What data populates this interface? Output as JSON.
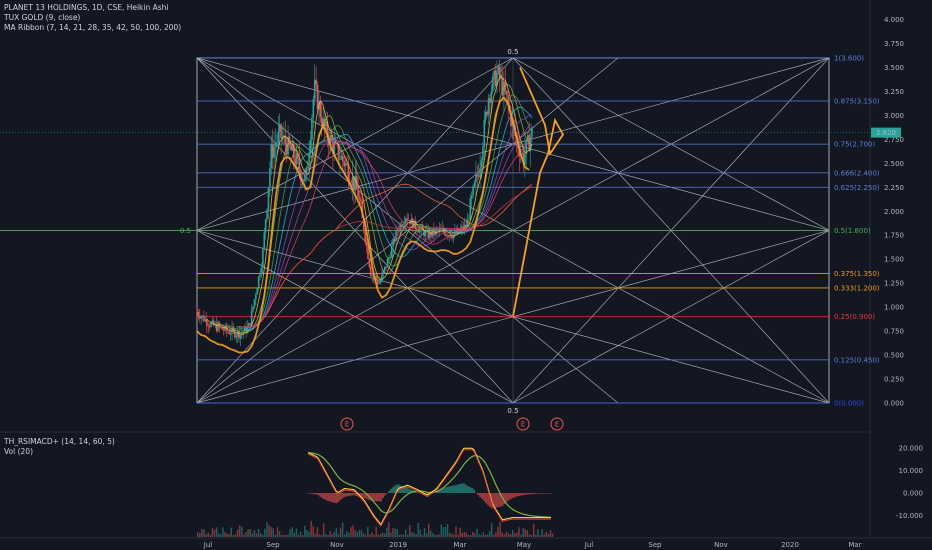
{
  "legend": {
    "symbol_line": "PLANET 13 HOLDINGS, 1D, CSE, Heikin Ashi",
    "indicator_1": "TUX GOLD (9, close)",
    "indicator_2": "MA Ribbon (7, 14, 21, 28, 35, 42, 50, 100, 200)",
    "lower_1": "TH_RSIMACD+ (14, 14, 60, 5)",
    "lower_2": "Vol (20)"
  },
  "colors": {
    "background": "#131722",
    "up": "#26a69a",
    "down": "#ef5350",
    "gann": "#c8cbd4",
    "orange": "#f7a21b",
    "blue_level": "#5b7fd6",
    "green_level": "#4caf50",
    "orange_level": "#f39c12",
    "red_level": "#e53935",
    "price_tag": "#26a69a"
  },
  "chart_data": {
    "type": "candlestick",
    "x_ticks": [
      "Jul",
      "Sep",
      "Nov",
      "2019",
      "Mar",
      "May",
      "Jul",
      "Sep",
      "Nov",
      "2020",
      "Mar"
    ],
    "y_ticks": [
      "4.000",
      "3.750",
      "3.500",
      "3.250",
      "3.000",
      "2.750",
      "2.500",
      "2.250",
      "2.000",
      "1.750",
      "1.500",
      "1.250",
      "1.000",
      "0.750",
      "0.500",
      "0.250",
      "0.000"
    ],
    "ylim": [
      -0.15,
      4.1
    ],
    "last_price": "2.820",
    "levels": [
      {
        "label": "1(3.600)",
        "value": 3.6,
        "color": "blue"
      },
      {
        "label": "0.875(3.150)",
        "value": 3.15,
        "color": "blue"
      },
      {
        "label": "0.75(2.700)",
        "value": 2.7,
        "color": "blue"
      },
      {
        "label": "0.666(2.400)",
        "value": 2.4,
        "color": "blue"
      },
      {
        "label": "0.625(2.250)",
        "value": 2.25,
        "color": "blue"
      },
      {
        "label": "0.5(1.800)",
        "value": 1.8,
        "color": "green"
      },
      {
        "label": "0.375(1.350)",
        "value": 1.35,
        "color": "orange"
      },
      {
        "label": "0.333(1.200)",
        "value": 1.2,
        "color": "orange"
      },
      {
        "label": "0.25(0.900)",
        "value": 0.9,
        "color": "red"
      },
      {
        "label": "0.125(0.450)",
        "value": 0.45,
        "color": "blue"
      },
      {
        "label": "0(0.000)",
        "value": 0.0,
        "color": "navy"
      }
    ],
    "gann_labels": [
      "0.5",
      "0.5",
      "0.5"
    ],
    "event_markers": [
      "E",
      "E",
      "E"
    ],
    "price_path": [
      [
        0,
        0.95
      ],
      [
        0.03,
        0.82
      ],
      [
        0.07,
        0.75
      ],
      [
        0.1,
        0.72
      ],
      [
        0.12,
        0.8
      ],
      [
        0.15,
        1.5
      ],
      [
        0.17,
        2.6
      ],
      [
        0.19,
        2.8
      ],
      [
        0.22,
        2.6
      ],
      [
        0.25,
        2.3
      ],
      [
        0.27,
        3.3
      ],
      [
        0.29,
        2.9
      ],
      [
        0.31,
        2.7
      ],
      [
        0.34,
        2.5
      ],
      [
        0.37,
        2.2
      ],
      [
        0.4,
        1.35
      ],
      [
        0.42,
        1.25
      ],
      [
        0.44,
        1.5
      ],
      [
        0.46,
        1.8
      ],
      [
        0.48,
        1.95
      ],
      [
        0.5,
        1.85
      ],
      [
        0.53,
        1.75
      ],
      [
        0.56,
        1.8
      ],
      [
        0.59,
        1.75
      ],
      [
        0.62,
        1.85
      ],
      [
        0.65,
        2.5
      ],
      [
        0.67,
        3.2
      ],
      [
        0.69,
        3.45
      ],
      [
        0.71,
        3.2
      ],
      [
        0.73,
        2.8
      ],
      [
        0.75,
        2.55
      ],
      [
        0.77,
        2.82
      ]
    ],
    "lower_ticks": [
      "20.000",
      "10.000",
      "0.000",
      "-10.000"
    ],
    "lower_ylim": [
      -14,
      24
    ],
    "rsi_path": [
      [
        0,
        18
      ],
      [
        0.04,
        16
      ],
      [
        0.08,
        8
      ],
      [
        0.12,
        0
      ],
      [
        0.15,
        2
      ],
      [
        0.19,
        1.5
      ],
      [
        0.23,
        -3
      ],
      [
        0.27,
        -10
      ],
      [
        0.3,
        -14
      ],
      [
        0.33,
        -8
      ],
      [
        0.37,
        2
      ],
      [
        0.41,
        3.5
      ],
      [
        0.45,
        1.5
      ],
      [
        0.49,
        -1
      ],
      [
        0.53,
        2
      ],
      [
        0.57,
        8
      ],
      [
        0.61,
        14
      ],
      [
        0.64,
        20
      ],
      [
        0.68,
        20
      ],
      [
        0.72,
        10
      ],
      [
        0.76,
        -5
      ],
      [
        0.8,
        -12
      ],
      [
        0.84,
        -11
      ]
    ]
  }
}
